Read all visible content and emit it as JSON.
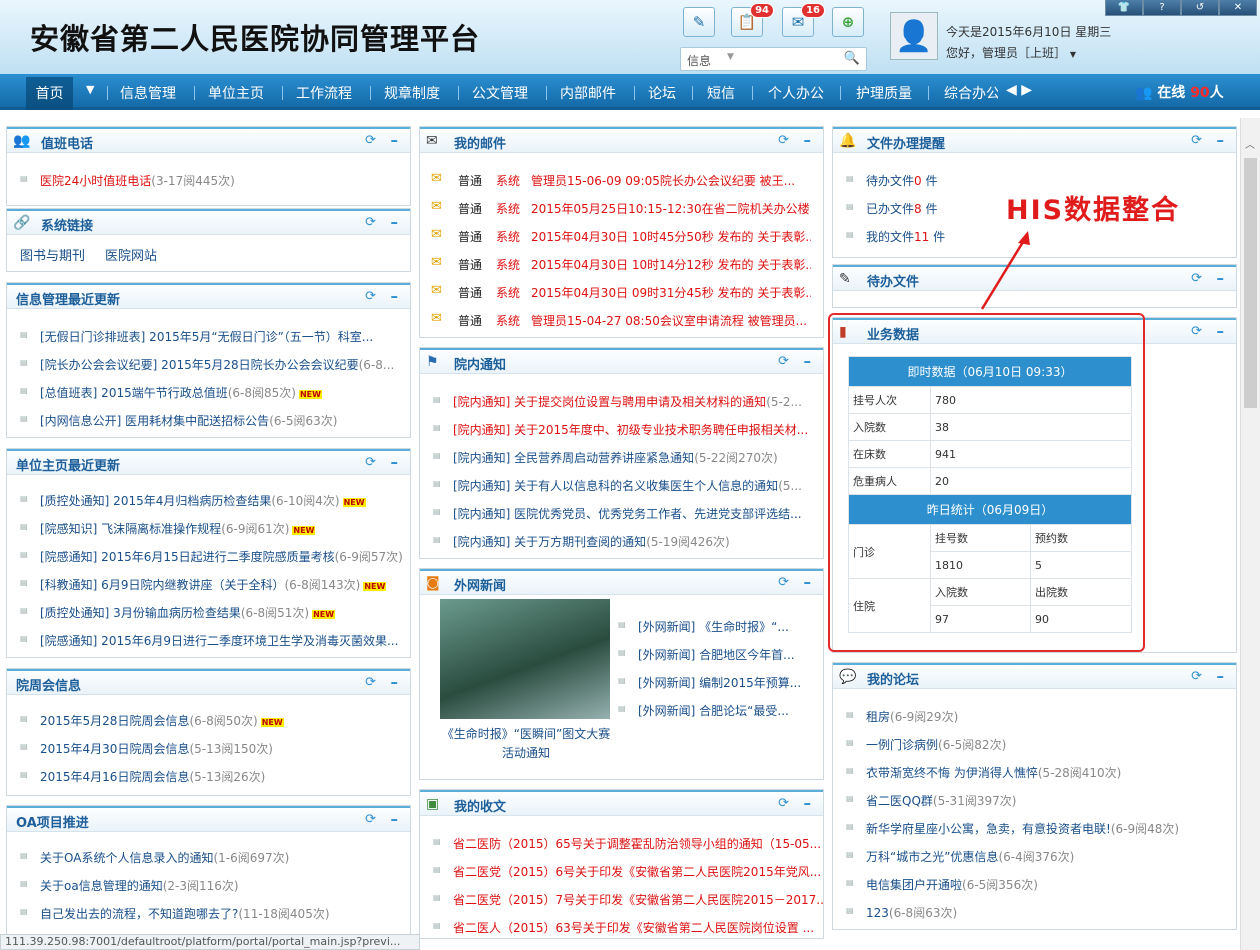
{
  "app": {
    "title": "安徽省第二人民医院协同管理平台"
  },
  "toolbar": {
    "mail_count": "94",
    "message_count": "16"
  },
  "search": {
    "category": "信息"
  },
  "header": {
    "date": "今天是2015年6月10日 星期三",
    "greeting": "您好，管理员［上班］"
  },
  "window_buttons": [
    "shirt-icon",
    "help-icon",
    "refresh-icon",
    "close-icon"
  ],
  "nav": {
    "home": "首页",
    "items": [
      "信息管理",
      "单位主页",
      "工作流程",
      "规章制度",
      "公文管理",
      "内部邮件",
      "论坛",
      "短信",
      "个人办公",
      "护理质量",
      "综合办公"
    ],
    "online_label": "在线",
    "online_count": "90",
    "online_unit": "人"
  },
  "duty": {
    "title": "值班电话",
    "items": [
      {
        "text": "医院24小时值班电话",
        "meta": "(3-17阅445次)"
      }
    ]
  },
  "syslinks": {
    "title": "系统链接",
    "items": [
      "图书与期刊",
      "医院网站"
    ]
  },
  "infomgmt": {
    "title": "信息管理最近更新",
    "items": [
      {
        "text": "[无假日门诊排班表] 2015年5月“无假日门诊”（五一节）科室...",
        "meta": "",
        "isnew": false
      },
      {
        "text": "[院长办公会会议纪要] 2015年5月28日院长办公会会议纪要",
        "meta": "(6-8...",
        "isnew": false
      },
      {
        "text": "[总值班表] 2015端午节行政总值班",
        "meta": "(6-8阅85次)",
        "isnew": true
      },
      {
        "text": "[内网信息公开] 医用耗材集中配送招标公告",
        "meta": "(6-5阅63次)",
        "isnew": false
      }
    ]
  },
  "unithome": {
    "title": "单位主页最近更新",
    "items": [
      {
        "text": "[质控处通知] 2015年4月归档病历检查结果",
        "meta": "(6-10阅4次)",
        "isnew": true
      },
      {
        "text": "[院感知识] 飞沫隔离标准操作规程",
        "meta": "(6-9阅61次)",
        "isnew": true
      },
      {
        "text": "[院感通知] 2015年6月15日起进行二季度院感质量考核",
        "meta": "(6-9阅57次)",
        "isnew": false
      },
      {
        "text": "[科教通知] 6月9日院内继教讲座（关于全科）",
        "meta": "(6-8阅143次)",
        "isnew": true
      },
      {
        "text": "[质控处通知] 3月份输血病历检查结果",
        "meta": "(6-8阅51次)",
        "isnew": true
      },
      {
        "text": "[院感通知] 2015年6月9日进行二季度环境卫生学及消毒灭菌效果...",
        "meta": "",
        "isnew": false
      }
    ]
  },
  "weekly": {
    "title": "院周会信息",
    "items": [
      {
        "text": "2015年5月28日院周会信息",
        "meta": "(6-8阅50次)",
        "isnew": true
      },
      {
        "text": "2015年4月30日院周会信息",
        "meta": "(5-13阅150次)",
        "isnew": false
      },
      {
        "text": "2015年4月16日院周会信息",
        "meta": "(5-13阅26次)",
        "isnew": false
      }
    ]
  },
  "oa": {
    "title": "OA项目推进",
    "items": [
      {
        "text": "关于OA系统个人信息录入的通知",
        "meta": "(1-6阅697次)"
      },
      {
        "text": "关于oa信息管理的通知",
        "meta": "(2-3阅116次)"
      },
      {
        "text": "自己发出去的流程，不知道跑哪去了?",
        "meta": "(11-18阅405次)"
      }
    ]
  },
  "mail": {
    "title": "我的邮件",
    "items": [
      {
        "p": "普通",
        "s": "系统",
        "t": "管理员15-06-09 09:05院长办公会议纪要 被王..."
      },
      {
        "p": "普通",
        "s": "系统",
        "t": "2015年05月25日10:15-12:30在省二院机关办公楼..."
      },
      {
        "p": "普通",
        "s": "系统",
        "t": "2015年04月30日 10时45分50秒 发布的 关于表彰..."
      },
      {
        "p": "普通",
        "s": "系统",
        "t": "2015年04月30日 10时14分12秒 发布的 关于表彰..."
      },
      {
        "p": "普通",
        "s": "系统",
        "t": "2015年04月30日 09时31分45秒 发布的 关于表彰..."
      },
      {
        "p": "普通",
        "s": "系统",
        "t": "管理员15-04-27 08:50会议室申请流程 被管理员..."
      }
    ]
  },
  "notice": {
    "title": "院内通知",
    "items": [
      {
        "text": "[院内通知] 关于提交岗位设置与聘用申请及相关材料的通知",
        "meta": "(5-2...",
        "red": true
      },
      {
        "text": "[院内通知] 关于2015年度中、初级专业技术职务聘任申报相关材...",
        "meta": "",
        "red": true
      },
      {
        "text": "[院内通知] 全民营养周启动营养讲座紧急通知",
        "meta": "(5-22阅270次)",
        "red": false
      },
      {
        "text": "[院内通知] 关于有人以信息科的名义收集医生个人信息的通知",
        "meta": "(5...",
        "red": false
      },
      {
        "text": "[院内通知] 医院优秀党员、优秀党务工作者、先进党支部评选结...",
        "meta": "",
        "red": false
      },
      {
        "text": "[院内通知] 关于万方期刊查阅的通知",
        "meta": "(5-19阅426次)",
        "red": false
      }
    ]
  },
  "extnews": {
    "title": "外网新闻",
    "caption": "《生命时报》“医瞬间”图文大赛活动通知",
    "items": [
      "[外网新闻] 《生命时报》“...",
      "[外网新闻] 合肥地区今年首...",
      "[外网新闻] 编制2015年预算...",
      "[外网新闻] 合肥论坛“最受..."
    ]
  },
  "received": {
    "title": "我的收文",
    "items": [
      "省二医防（2015）65号关于调整霍乱防治领导小组的通知（15-05...",
      "省二医党（2015）6号关于印发《安徽省第二人民医院2015年党风...",
      "省二医党（2015）7号关于印发《安徽省第二人民医院2015－2017...",
      "省二医人（2015）63号关于印发《安徽省第二人民医院岗位设置 ..."
    ]
  },
  "docremind": {
    "title": "文件办理提醒",
    "items": [
      {
        "label": "待办文件",
        "count": "0",
        "unit": " 件"
      },
      {
        "label": "已办文件",
        "count": "8",
        "unit": " 件"
      },
      {
        "label": "我的文件",
        "count": "11",
        "unit": " 件"
      }
    ]
  },
  "pending": {
    "title": "待办文件"
  },
  "business": {
    "title": "业务数据",
    "realtime_header": "即时数据（06月10日 09:33）",
    "rows": [
      {
        "k": "挂号人次",
        "v": "780"
      },
      {
        "k": "入院数",
        "v": "38"
      },
      {
        "k": "在床数",
        "v": "941"
      },
      {
        "k": "危重病人",
        "v": "20"
      }
    ],
    "yesterday_header": "昨日统计（06月09日）",
    "outpatient": "门诊",
    "reg_label": "挂号数",
    "appt_label": "预约数",
    "reg_val": "1810",
    "appt_val": "5",
    "inpatient": "住院",
    "adm_label": "入院数",
    "dis_label": "出院数",
    "adm_val": "97",
    "dis_val": "90"
  },
  "annotation": {
    "text": "HIS数据整合"
  },
  "forum": {
    "title": "我的论坛",
    "items": [
      {
        "text": "租房",
        "meta": "(6-9阅29次)"
      },
      {
        "text": "一例门诊病例",
        "meta": "(6-5阅82次)"
      },
      {
        "text": "衣带渐宽终不悔 为伊消得人憔悴",
        "meta": "(5-28阅410次)"
      },
      {
        "text": "省二医QQ群",
        "meta": "(5-31阅397次)"
      },
      {
        "text": "新华学府星座小公寓，急卖，有意投资者电联!",
        "meta": "(6-9阅48次)"
      },
      {
        "text": "万科“城市之光”优惠信息",
        "meta": "(6-4阅376次)"
      },
      {
        "text": "电信集团户开通啦",
        "meta": "(6-5阅356次)"
      },
      {
        "text": "123",
        "meta": "(6-8阅63次)"
      }
    ]
  },
  "statusbar": {
    "url": "111.39.250.98:7001/defaultroot/platform/portal/portal_main.jsp?previ..."
  },
  "colors": {
    "nav_blue": "#1c7cc0",
    "accent_red": "#d11111",
    "title_blue": "#1d5f9a"
  }
}
